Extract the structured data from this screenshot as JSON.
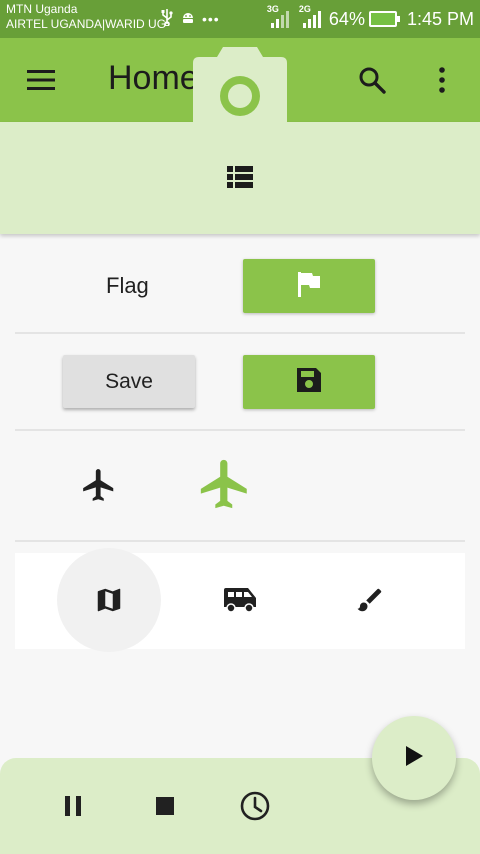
{
  "status_bar": {
    "carrier_primary": "MTN Uganda",
    "carrier_secondary": "AIRTEL UGANDA|WARID UG",
    "network_1": "3G",
    "network_2": "2G",
    "battery_percent": "64%",
    "time": "1:45 PM",
    "icons": [
      "usb-icon",
      "android-icon",
      "more-dots-icon",
      "signal-icon",
      "signal-icon",
      "battery-charging-icon"
    ]
  },
  "toolbar": {
    "title": "Home",
    "menu_icon": "menu-icon",
    "search_icon": "search-icon",
    "more_icon": "more-vert-icon",
    "camera_icon": "camera-icon"
  },
  "subheader": {
    "icon": "view-list-icon"
  },
  "rows": {
    "flag_label": "Flag",
    "flag_button_icon": "flag-icon",
    "save_label": "Save",
    "save_button_icon": "save-icon",
    "plane_icons": [
      "airplane-icon-small",
      "airplane-icon-large"
    ],
    "strip_icons": [
      "map-icon",
      "van-icon",
      "brush-icon"
    ]
  },
  "bottom_bar": {
    "icons": [
      "pause-icon",
      "stop-icon",
      "history-icon"
    ],
    "fab_icon": "play-icon"
  },
  "colors": {
    "status_bar": "#689f38",
    "primary": "#8bc34a",
    "primary_light": "#dcedc8",
    "background": "#f7f7f7",
    "text": "#212121"
  }
}
